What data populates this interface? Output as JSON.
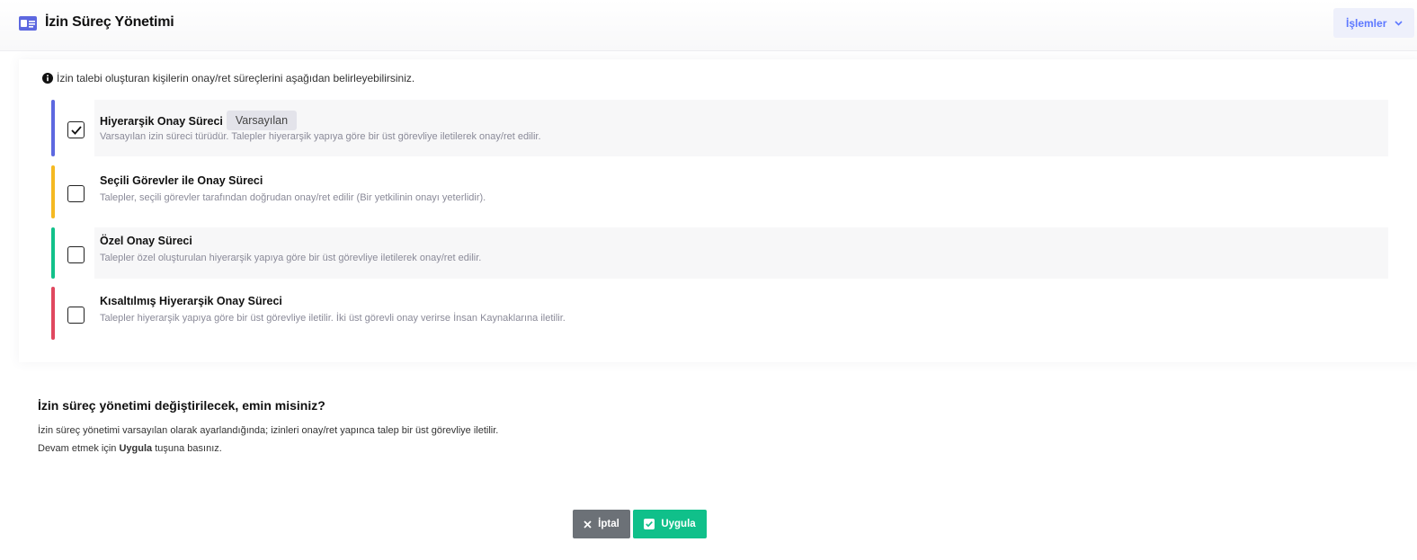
{
  "header": {
    "title": "İzin Süreç Yönetimi",
    "icon": "id-card-icon",
    "actions_label": "İşlemler"
  },
  "info_text": "İzin talebi oluşturan kişilerin onay/ret süreçlerini aşağıdan belirleyebilirsiniz.",
  "options": [
    {
      "title": "Hiyerarşik Onay Süreci",
      "badge": "Varsayılan",
      "description": "Varsayılan izin süreci türüdür. Talepler hiyerarşik yapıya göre bir üst görevliye iletilerek onay/ret edilir.",
      "checked": true,
      "color": "#5d68e0"
    },
    {
      "title": "Seçili Görevler ile Onay Süreci",
      "description": "Talepler, seçili görevler tarafından doğrudan onay/ret edilir (Bir yetkilinin onayı yeterlidir).",
      "checked": false,
      "color": "#f5b922"
    },
    {
      "title": "Özel Onay Süreci",
      "description": "Talepler özel oluşturulan hiyerarşik yapıya göre bir üst görevliye iletilerek onay/ret edilir.",
      "checked": false,
      "color": "#12c18a"
    },
    {
      "title": "Kısaltılmış Hiyerarşik Onay Süreci",
      "description": "Talepler hiyerarşik yapıya göre bir üst görevliye iletilir. İki üst görevli onay verirse İnsan Kaynaklarına iletilir.",
      "checked": false,
      "color": "#e0485f"
    }
  ],
  "confirm": {
    "title": "İzin süreç yönetimi değiştirilecek, emin misiniz?",
    "line1": "İzin süreç yönetimi varsayılan olarak ayarlandığında; izinleri onay/ret yapınca talep bir üst görevliye iletilir.",
    "line2_prefix": "Devam etmek için ",
    "line2_bold": "Uygula",
    "line2_suffix": " tuşuna basınız."
  },
  "buttons": {
    "cancel_label": "İptal",
    "apply_label": "Uygula"
  }
}
